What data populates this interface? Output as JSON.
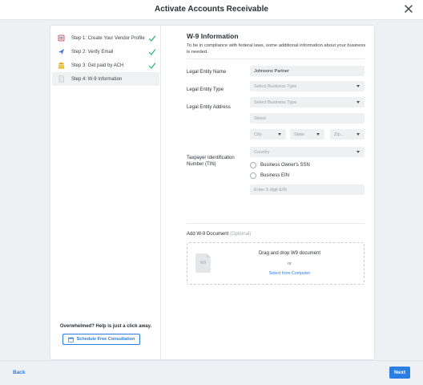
{
  "header": {
    "title": "Activate Accounts Receivable"
  },
  "sidebar": {
    "steps": [
      {
        "label": "Step 1: Create Your Vendor Profile",
        "completed": true
      },
      {
        "label": "Step 2: Verify Email",
        "completed": true
      },
      {
        "label": "Step 3: Get paid by ACH",
        "completed": true
      },
      {
        "label": "Step 4: W-9 Information",
        "completed": false,
        "active": true
      }
    ],
    "help_text": "Overwhelmed? Help is just a click away.",
    "consult_label": "Schedule Free Consultation"
  },
  "form": {
    "title": "W-9 Information",
    "intro": "To be in compliance with federal laws, some additional information about your business is needed.",
    "legal_entity_name_label": "Legal Entity Name",
    "legal_entity_name_value": "Johnsons Partner",
    "legal_entity_type_label": "Legal Entity Type",
    "legal_entity_type_placeholder": "Select Business Type",
    "legal_entity_address_label": "Legal Entity Address",
    "address_type_placeholder": "Select Business Type",
    "street_placeholder": "Street",
    "city_placeholder": "City",
    "state_placeholder": "State",
    "zip_placeholder": "Zip...",
    "country_placeholder": "Country",
    "tin_label": "Taxpayer Identification Number (TIN)",
    "ssn_option": "Business Owner's SSN",
    "ein_option": "Business EIN",
    "ein_placeholder": "Enter 9 digit EIN",
    "upload_label": "Add W-9 Document",
    "upload_optional": "(Optional)",
    "dropzone_text": "Drag and drop W9 document",
    "dropzone_or": "or",
    "dropzone_link": "Select from Computer",
    "doc_icon_text": "W9"
  },
  "footer": {
    "back_label": "Back",
    "next_label": "Next"
  },
  "colors": {
    "accent": "#2a7de1",
    "check": "#27b36a",
    "field_bg": "#eef0f2"
  },
  "icons": [
    "close-icon",
    "vendor-profile-icon",
    "verify-email-icon",
    "bank-icon",
    "document-icon",
    "check-icon",
    "calendar-icon"
  ]
}
